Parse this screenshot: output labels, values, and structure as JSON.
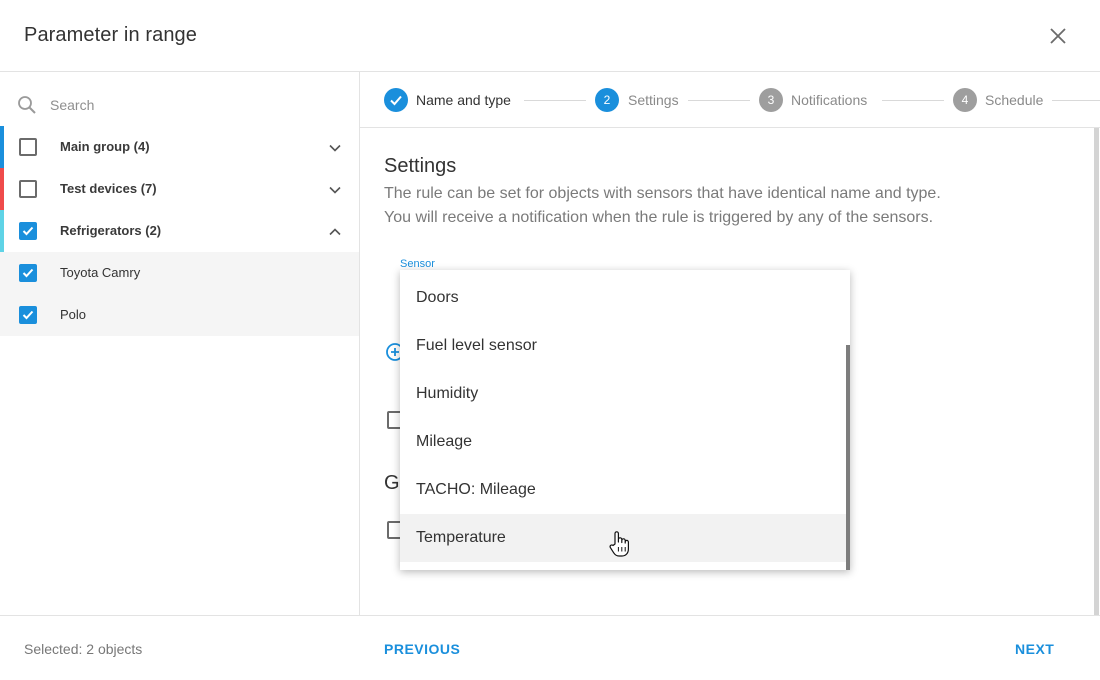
{
  "dialog": {
    "title": "Parameter in range"
  },
  "sidebar": {
    "search_placeholder": "Search",
    "items": [
      {
        "label": "Main group (4)",
        "color": "#1a8fdc",
        "checked": false,
        "expanded": false
      },
      {
        "label": "Test devices (7)",
        "color": "#ef4b4b",
        "checked": false,
        "expanded": false
      },
      {
        "label": "Refrigerators (2)",
        "color": "#5fd3e6",
        "checked": true,
        "expanded": true
      },
      {
        "label": "Toyota Camry",
        "checked": true
      },
      {
        "label": "Polo",
        "checked": true
      }
    ]
  },
  "stepper": {
    "steps": [
      {
        "label": "Name and type",
        "state": "done"
      },
      {
        "number": "2",
        "label": "Settings",
        "state": "active"
      },
      {
        "number": "3",
        "label": "Notifications",
        "state": "pending"
      },
      {
        "number": "4",
        "label": "Schedule",
        "state": "pending"
      }
    ]
  },
  "settings": {
    "title": "Settings",
    "description_line1": "The rule can be set for objects with sensors that have identical name and type.",
    "description_line2": "You will receive a notification when the rule is triggered by any of the sensors.",
    "sensor_label": "Sensor",
    "partial_heading": "G"
  },
  "dropdown": {
    "options": [
      "Doors",
      "Fuel level sensor",
      "Humidity",
      "Mileage",
      "TACHO: Mileage",
      "Temperature"
    ],
    "hovered": "Temperature"
  },
  "footer": {
    "selected": "Selected: 2 objects",
    "previous": "PREVIOUS",
    "next": "NEXT"
  },
  "colors": {
    "accent": "#1a8fdc",
    "pending": "#9e9e9e"
  }
}
